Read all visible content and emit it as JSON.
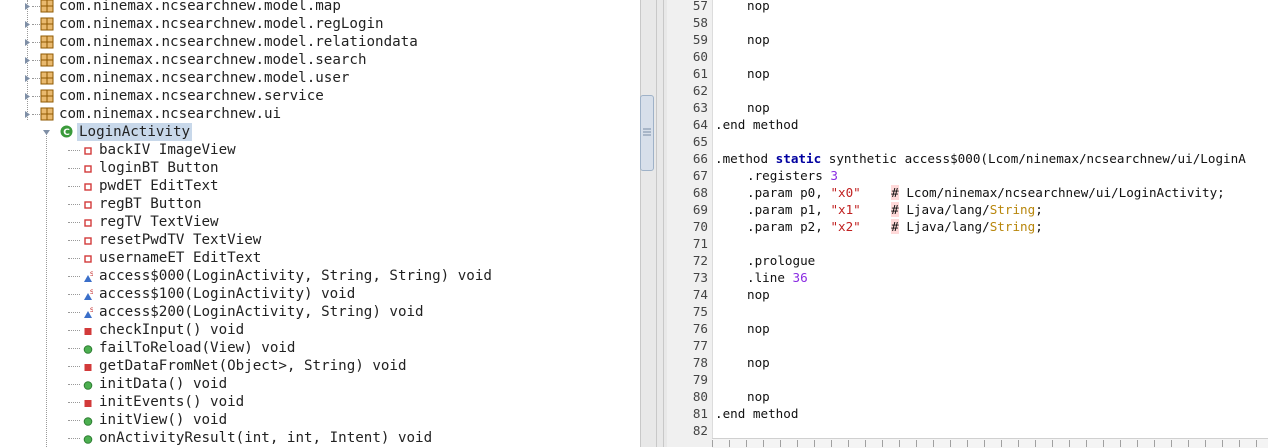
{
  "tree": {
    "packages": [
      "com.ninemax.ncsearchnew.model.map",
      "com.ninemax.ncsearchnew.model.regLogin",
      "com.ninemax.ncsearchnew.model.relationdata",
      "com.ninemax.ncsearchnew.model.search",
      "com.ninemax.ncsearchnew.model.user",
      "com.ninemax.ncsearchnew.service",
      "com.ninemax.ncsearchnew.ui"
    ],
    "selected_class": "LoginActivity",
    "members": [
      {
        "label": "backIV ImageView",
        "icon": "field-private-icon"
      },
      {
        "label": "loginBT Button",
        "icon": "field-private-icon"
      },
      {
        "label": "pwdET EditText",
        "icon": "field-private-icon"
      },
      {
        "label": "regBT Button",
        "icon": "field-private-icon"
      },
      {
        "label": "regTV TextView",
        "icon": "field-private-icon"
      },
      {
        "label": "resetPwdTV TextView",
        "icon": "field-private-icon"
      },
      {
        "label": "usernameET EditText",
        "icon": "field-private-icon"
      },
      {
        "label": "access$000(LoginActivity, String, String) void",
        "icon": "static-synthetic-method-icon"
      },
      {
        "label": "access$100(LoginActivity) void",
        "icon": "static-synthetic-method-icon"
      },
      {
        "label": "access$200(LoginActivity, String) void",
        "icon": "static-synthetic-method-icon"
      },
      {
        "label": "checkInput() void",
        "icon": "private-method-icon"
      },
      {
        "label": "failToReload(View) void",
        "icon": "public-method-icon"
      },
      {
        "label": "getDataFromNet(Object>, String) void",
        "icon": "private-method-icon"
      },
      {
        "label": "initData() void",
        "icon": "public-method-icon"
      },
      {
        "label": "initEvents() void",
        "icon": "private-method-icon"
      },
      {
        "label": "initView() void",
        "icon": "public-method-icon"
      },
      {
        "label": "onActivityResult(int, int, Intent) void",
        "icon": "public-method-icon"
      }
    ]
  },
  "code": {
    "line_numbers": [
      "57",
      "58",
      "59",
      "60",
      "61",
      "62",
      "63",
      "64",
      "65",
      "66",
      "67",
      "68",
      "69",
      "70",
      "71",
      "72",
      "73",
      "74",
      "75",
      "76",
      "77",
      "78",
      "79",
      "80",
      "81",
      "82"
    ],
    "text": {
      "nop": "nop",
      "end_method": ".end method",
      "method_kw": ".method",
      "static_kw": "static",
      "method_sig": "synthetic access$000(Lcom/ninemax/ncsearchnew/ui/LoginA",
      "registers": ".registers",
      "registers_num": "3",
      "param": ".param",
      "p0": "p0,",
      "p1": "p1,",
      "p2": "p2,",
      "x0": "\"x0\"",
      "x1": "\"x1\"",
      "x2": "\"x2\"",
      "hash": "#",
      "c0": "Lcom/ninemax/ncsearchnew/ui/LoginActivity;",
      "c1a": "Ljava/lang/",
      "c1b": "String",
      "c1c": ";",
      "prologue": ".prologue",
      "line": ".line",
      "line_num": "36"
    }
  },
  "colors": {
    "keyword": "#0000a0",
    "number": "#8a2be2",
    "string": "#c02020",
    "type": "#b8860b",
    "selection": "#c8d8ea"
  }
}
